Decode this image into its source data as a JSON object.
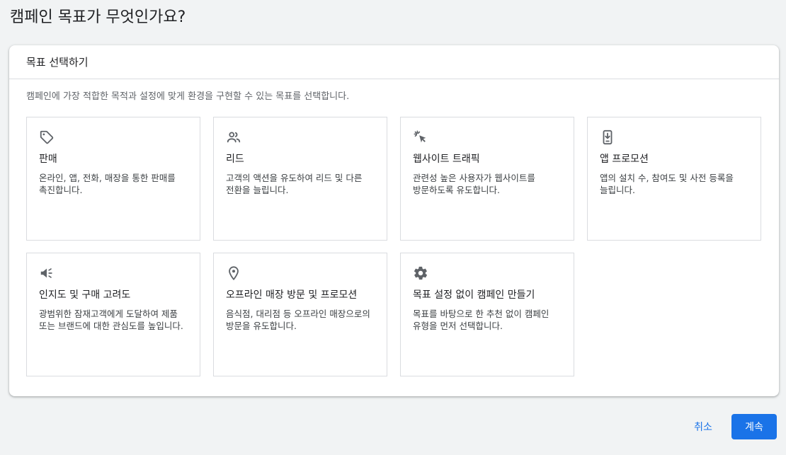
{
  "page": {
    "title": "캠페인 목표가 무엇인가요?"
  },
  "panel": {
    "header": "목표 선택하기",
    "description": "캠페인에 가장 적합한 목적과 설정에 맞게 환경을 구현할 수 있는 목표를 선택합니다."
  },
  "goals": [
    {
      "icon": "tag-icon",
      "title": "판매",
      "description": "온라인, 앱, 전화, 매장을 통한 판매를 촉진합니다."
    },
    {
      "icon": "people-icon",
      "title": "리드",
      "description": "고객의 액션을 유도하여 리드 및 다른 전환을 늘립니다."
    },
    {
      "icon": "cursor-click-icon",
      "title": "웹사이트 트래픽",
      "description": "관련성 높은 사용자가 웹사이트를 방문하도록 유도합니다."
    },
    {
      "icon": "mobile-download-icon",
      "title": "앱 프로모션",
      "description": "앱의 설치 수, 참여도 및 사전 등록을 늘립니다."
    },
    {
      "icon": "megaphone-icon",
      "title": "인지도 및 구매 고려도",
      "description": "광범위한 잠재고객에게 도달하여 제품 또는 브랜드에 대한 관심도를 높입니다."
    },
    {
      "icon": "location-pin-icon",
      "title": "오프라인 매장 방문 및 프로모션",
      "description": "음식점, 대리점 등 오프라인 매장으로의 방문을 유도합니다."
    },
    {
      "icon": "gear-icon",
      "title": "목표 설정 없이 캠페인 만들기",
      "description": "목표를 바탕으로 한 추천 없이 캠페인 유형을 먼저 선택합니다."
    }
  ],
  "actions": {
    "cancel_label": "취소",
    "continue_label": "계속"
  },
  "colors": {
    "primary": "#1a73e8",
    "icon": "#5f6368",
    "border": "#dadce0",
    "background": "#f1f3f4"
  }
}
